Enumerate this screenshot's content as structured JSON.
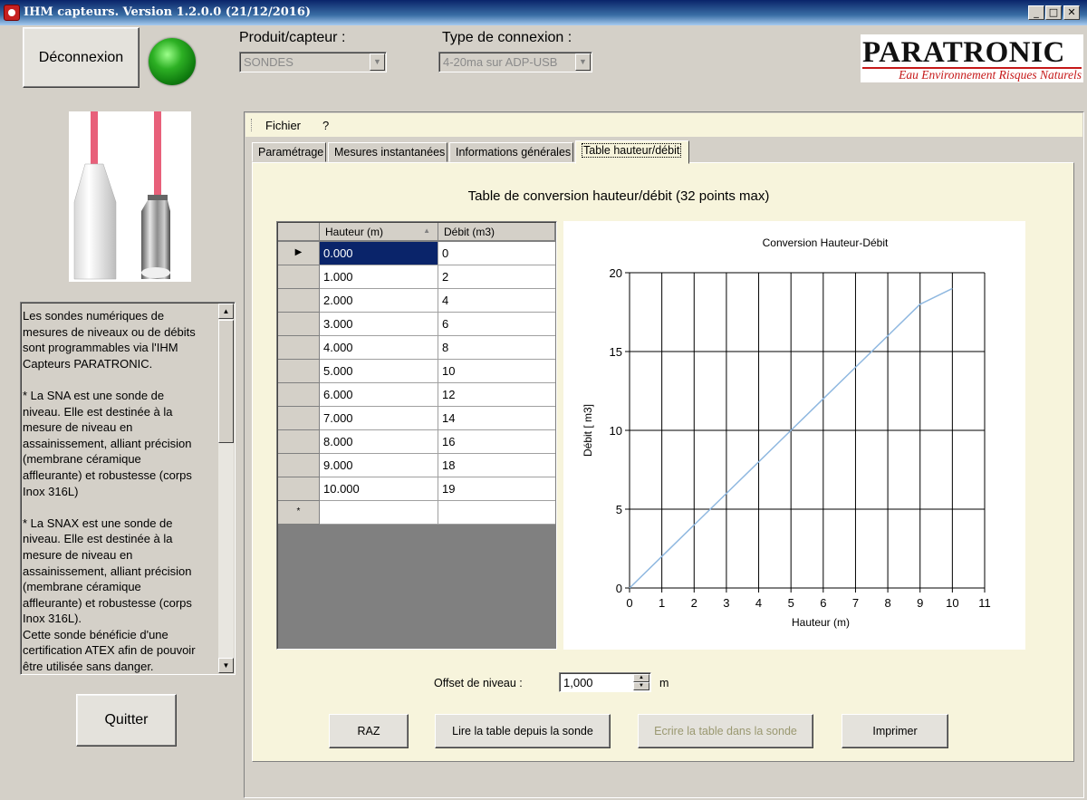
{
  "window": {
    "title": "IHM capteurs. Version 1.2.0.0 (21/12/2016)",
    "minimize": "_",
    "maximize": "□",
    "close": "✕"
  },
  "header": {
    "logout_label": "Déconnexion",
    "connection_status": "connected",
    "product_label": "Produit/capteur :",
    "product_value": "SONDES",
    "connection_type_label": "Type de connexion :",
    "connection_type_value": "4-20ma sur ADP-USB",
    "logo_name": "PARATRONIC",
    "logo_tagline": "Eau Environnement Risques Naturels"
  },
  "sidebar": {
    "description": "Les sondes numériques de\nmesures de niveaux ou de débits\nsont programmables via l'IHM\nCapteurs PARATRONIC.\n\n* La SNA est une sonde de\nniveau. Elle est destinée à la\nmesure de niveau en\nassainissement, alliant précision\n(membrane céramique\naffleurante) et robustesse (corps\nInox 316L)\n\n* La SNAX est une sonde de\nniveau. Elle est destinée à la\nmesure de niveau en\nassainissement, alliant précision\n(membrane céramique\naffleurante) et robustesse (corps\nInox 316L).\nCette sonde bénéficie d'une\ncertification ATEX afin de pouvoir\nêtre utilisée sans danger.",
    "quit_label": "Quitter"
  },
  "menu": {
    "file": "Fichier",
    "help": "?"
  },
  "tabs": [
    {
      "label": "Paramétrage"
    },
    {
      "label": "Mesures instantanées"
    },
    {
      "label": "Informations générales"
    },
    {
      "label": "Table hauteur/débit",
      "active": true
    }
  ],
  "table_page": {
    "title": "Table de conversion hauteur/débit (32 points max)",
    "grid": {
      "col_height": "Hauteur (m)",
      "col_flow": "Débit (m3)",
      "sort_glyph": "▲",
      "current_row_glyph": "▶",
      "new_row_glyph": "*",
      "rows": [
        {
          "h": "0.000",
          "q": "0"
        },
        {
          "h": "1.000",
          "q": "2"
        },
        {
          "h": "2.000",
          "q": "4"
        },
        {
          "h": "3.000",
          "q": "6"
        },
        {
          "h": "4.000",
          "q": "8"
        },
        {
          "h": "5.000",
          "q": "10"
        },
        {
          "h": "6.000",
          "q": "12"
        },
        {
          "h": "7.000",
          "q": "14"
        },
        {
          "h": "8.000",
          "q": "16"
        },
        {
          "h": "9.000",
          "q": "18"
        },
        {
          "h": "10.000",
          "q": "19"
        }
      ]
    },
    "offset_label": "Offset de niveau :",
    "offset_value": "1,000",
    "offset_unit": "m",
    "buttons": {
      "reset": "RAZ",
      "read": "Lire la table depuis la sonde",
      "write": "Ecrire la table dans la sonde",
      "print": "Imprimer"
    }
  },
  "chart_data": {
    "type": "line",
    "title": "Conversion Hauteur-Débit",
    "xlabel": "Hauteur (m)",
    "ylabel": "Débit [ m3]",
    "x": [
      0,
      1,
      2,
      3,
      4,
      5,
      6,
      7,
      8,
      9,
      10
    ],
    "series": [
      {
        "values": [
          0,
          2,
          4,
          6,
          8,
          10,
          12,
          14,
          16,
          18,
          19
        ],
        "color": "#8fb8e0"
      }
    ],
    "xlim": [
      0,
      11
    ],
    "ylim": [
      0,
      20
    ],
    "xticks": [
      0,
      1,
      2,
      3,
      4,
      5,
      6,
      7,
      8,
      9,
      10,
      11
    ],
    "yticks": [
      0,
      5,
      10,
      15,
      20
    ],
    "grid": true,
    "legend": "none"
  }
}
